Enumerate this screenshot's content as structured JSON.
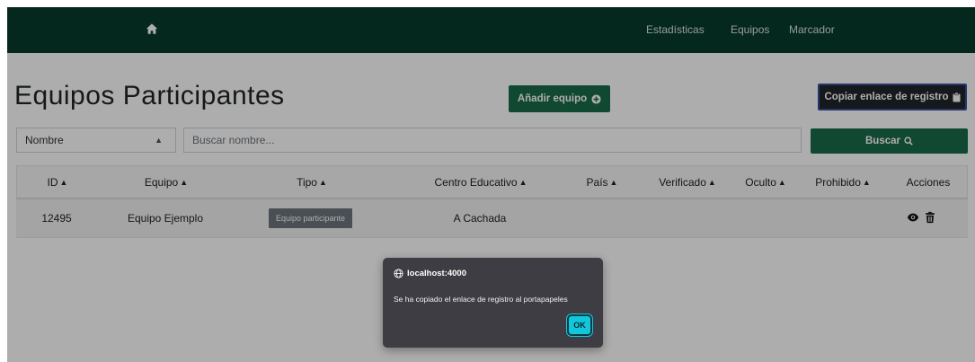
{
  "navbar": {
    "links": {
      "stats": "Estadísticas",
      "teams": "Equipos",
      "scoreboard": "Marcador"
    }
  },
  "page": {
    "title": "Equipos Participantes",
    "add_button": "Añadir equipo",
    "copy_button": "Copiar enlace de registro"
  },
  "search": {
    "filter_value": "Nombre",
    "placeholder": "Buscar nombre...",
    "button": "Buscar"
  },
  "table": {
    "headers": {
      "id": "ID",
      "team": "Equipo",
      "type": "Tipo",
      "school": "Centro Educativo",
      "country": "País",
      "verified": "Verificado",
      "hidden": "Oculto",
      "banned": "Prohibido",
      "actions": "Acciones"
    },
    "rows": [
      {
        "id": "12495",
        "team": "Equipo Ejemplo",
        "type": "Equipo participante",
        "school": "A Cachada",
        "country": "",
        "verified": "",
        "hidden": "",
        "banned": ""
      }
    ]
  },
  "dialog": {
    "origin": "localhost:4000",
    "message": "Se ha copiado el enlace de registro al portapapeles",
    "ok": "OK"
  },
  "colors": {
    "navbar": "#073c2b",
    "primary": "#1a6b4a",
    "dark_button": "#212529",
    "badge": "#6c757d",
    "dialog": "#3f3d44",
    "ok_button": "#12c7dc"
  }
}
